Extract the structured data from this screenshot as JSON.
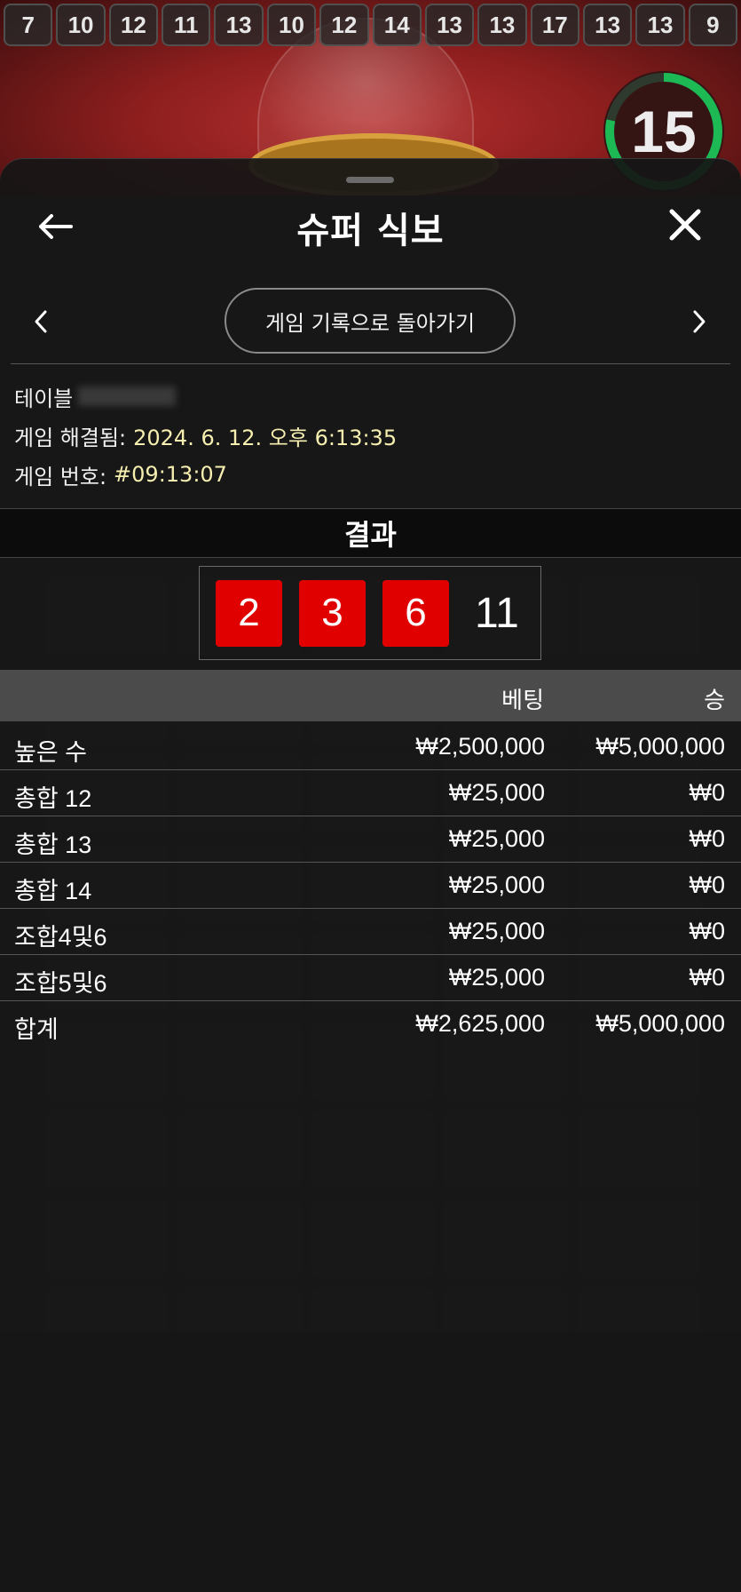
{
  "history": [
    "7",
    "10",
    "12",
    "11",
    "13",
    "10",
    "12",
    "14",
    "13",
    "13",
    "17",
    "13",
    "13",
    "9"
  ],
  "timer": {
    "value": "15",
    "accent": "#1db954"
  },
  "modal": {
    "title": "슈퍼 식보",
    "back_icon": "arrow-left-icon",
    "close_icon": "close-icon",
    "nav": {
      "prev_icon": "chevron-left-icon",
      "next_icon": "chevron-right-icon",
      "history_button": "게임 기록으로 돌아가기"
    },
    "info": {
      "table_label": "테이블",
      "resolved_label": "게임 해결됨:",
      "resolved_value": "2024. 6. 12. 오후 6:13:35",
      "game_number_label": "게임 번호:",
      "game_number_value": "#09:13:07"
    },
    "result": {
      "heading": "결과",
      "dice": [
        "2",
        "3",
        "6"
      ],
      "total": "11",
      "dice_color": "#e00000"
    },
    "bets_table": {
      "headers": {
        "bet": "베팅",
        "win": "승"
      },
      "rows": [
        {
          "name": "높은 수",
          "bet": "₩2,500,000",
          "win": "₩5,000,000"
        },
        {
          "name": "총합 12",
          "bet": "₩25,000",
          "win": "₩0"
        },
        {
          "name": "총합 13",
          "bet": "₩25,000",
          "win": "₩0"
        },
        {
          "name": "총합 14",
          "bet": "₩25,000",
          "win": "₩0"
        },
        {
          "name": "조합4및6",
          "bet": "₩25,000",
          "win": "₩0"
        },
        {
          "name": "조합5및6",
          "bet": "₩25,000",
          "win": "₩0"
        }
      ],
      "total": {
        "name": "합계",
        "bet": "₩2,625,000",
        "win": "₩5,000,000"
      }
    }
  }
}
